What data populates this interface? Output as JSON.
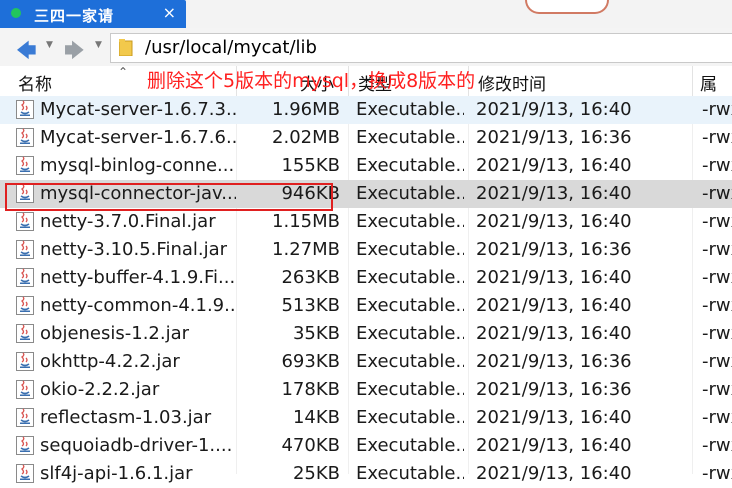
{
  "tab": {
    "title": "三四一家请",
    "close": "×"
  },
  "address": {
    "path": "/usr/local/mycat/lib"
  },
  "columns": {
    "name": "名称",
    "size": "大小",
    "type": "类型",
    "modified": "修改时间",
    "attr": "属性"
  },
  "annotation": "删除这个5版本的mysql，换成8版本的",
  "files": [
    {
      "name": "Mycat-server-1.6.7.3...",
      "size": "1.96MB",
      "type": "Executable...",
      "modified": "2021/9/13, 16:40",
      "attr": "-rwx"
    },
    {
      "name": "Mycat-server-1.6.7.6...",
      "size": "2.02MB",
      "type": "Executable...",
      "modified": "2021/9/13, 16:36",
      "attr": "-rwx"
    },
    {
      "name": "mysql-binlog-conne...",
      "size": "155KB",
      "type": "Executable...",
      "modified": "2021/9/13, 16:40",
      "attr": "-rwx"
    },
    {
      "name": "mysql-connector-jav...",
      "size": "946KB",
      "type": "Executable...",
      "modified": "2021/9/13, 16:40",
      "attr": "-rwx"
    },
    {
      "name": "netty-3.7.0.Final.jar",
      "size": "1.15MB",
      "type": "Executable...",
      "modified": "2021/9/13, 16:40",
      "attr": "-rwx"
    },
    {
      "name": "netty-3.10.5.Final.jar",
      "size": "1.27MB",
      "type": "Executable...",
      "modified": "2021/9/13, 16:36",
      "attr": "-rwx"
    },
    {
      "name": "netty-buffer-4.1.9.Fi...",
      "size": "263KB",
      "type": "Executable...",
      "modified": "2021/9/13, 16:40",
      "attr": "-rwx"
    },
    {
      "name": "netty-common-4.1.9...",
      "size": "513KB",
      "type": "Executable...",
      "modified": "2021/9/13, 16:40",
      "attr": "-rwx"
    },
    {
      "name": "objenesis-1.2.jar",
      "size": "35KB",
      "type": "Executable...",
      "modified": "2021/9/13, 16:40",
      "attr": "-rwx"
    },
    {
      "name": "okhttp-4.2.2.jar",
      "size": "693KB",
      "type": "Executable...",
      "modified": "2021/9/13, 16:36",
      "attr": "-rwx"
    },
    {
      "name": "okio-2.2.2.jar",
      "size": "178KB",
      "type": "Executable...",
      "modified": "2021/9/13, 16:36",
      "attr": "-rwx"
    },
    {
      "name": "reflectasm-1.03.jar",
      "size": "14KB",
      "type": "Executable...",
      "modified": "2021/9/13, 16:40",
      "attr": "-rwx"
    },
    {
      "name": "sequoiadb-driver-1....",
      "size": "470KB",
      "type": "Executable...",
      "modified": "2021/9/13, 16:40",
      "attr": "-rwx"
    },
    {
      "name": "slf4j-api-1.6.1.jar",
      "size": "25KB",
      "type": "Executable...",
      "modified": "2021/9/13, 16:40",
      "attr": "-rwx"
    }
  ],
  "selected_file": "mysql-connector-jav...",
  "icons": {
    "back": "arrow-left-icon",
    "forward": "arrow-right-icon",
    "folder": "folder-icon",
    "file": "jar-file-icon"
  },
  "colors": {
    "tab": "#1e6fd9",
    "selection": "#d9d9d9",
    "annotation": "#ff2020",
    "highlight_box": "#e02020"
  }
}
